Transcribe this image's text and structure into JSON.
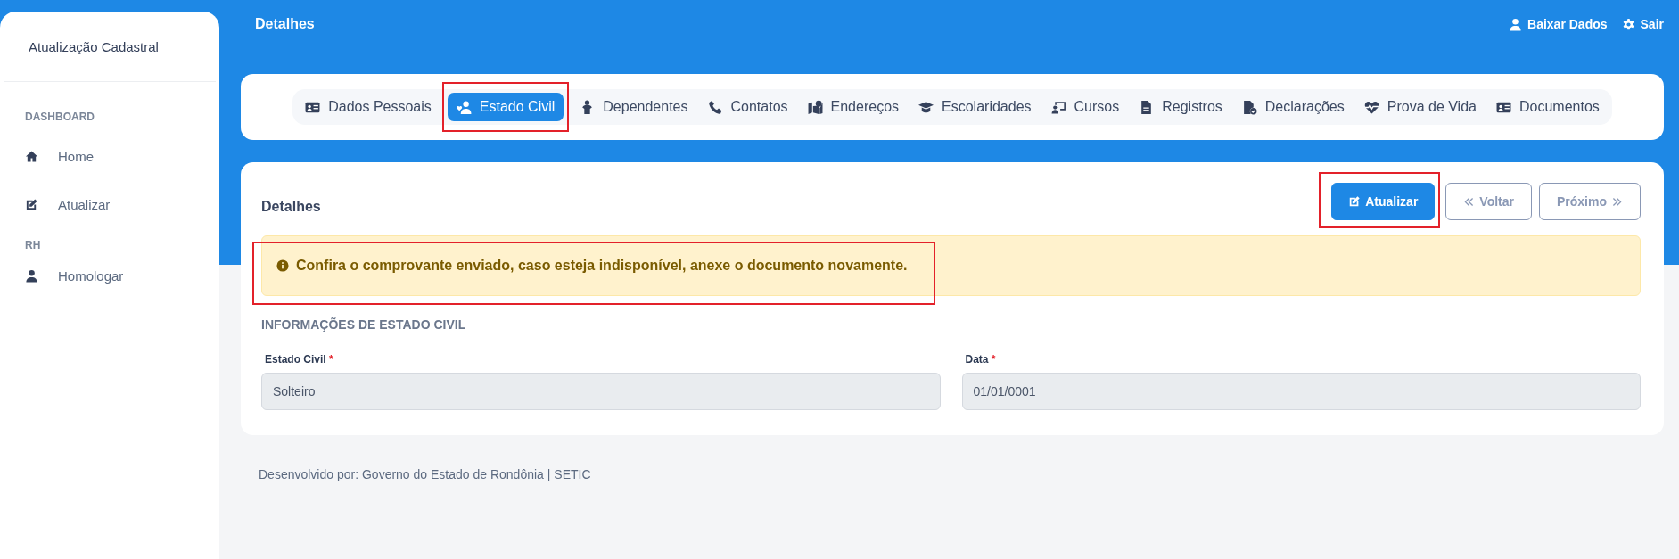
{
  "sidebar": {
    "title": "Atualização Cadastral",
    "sections": [
      {
        "heading": "DASHBOARD",
        "items": [
          {
            "label": "Home"
          },
          {
            "label": "Atualizar"
          }
        ]
      },
      {
        "heading": "RH",
        "items": [
          {
            "label": "Homologar"
          }
        ]
      }
    ]
  },
  "header": {
    "title": "Detalhes",
    "actions": [
      {
        "label": "Baixar Dados"
      },
      {
        "label": "Sair"
      }
    ]
  },
  "tabs": [
    {
      "label": "Dados Pessoais",
      "selected": false,
      "highlighted": false
    },
    {
      "label": "Estado Civil",
      "selected": true,
      "highlighted": true
    },
    {
      "label": "Dependentes",
      "selected": false,
      "highlighted": false
    },
    {
      "label": "Contatos",
      "selected": false,
      "highlighted": false
    },
    {
      "label": "Endereços",
      "selected": false,
      "highlighted": false
    },
    {
      "label": "Escolaridades",
      "selected": false,
      "highlighted": false
    },
    {
      "label": "Cursos",
      "selected": false,
      "highlighted": false
    },
    {
      "label": "Registros",
      "selected": false,
      "highlighted": false
    },
    {
      "label": "Declarações",
      "selected": false,
      "highlighted": false
    },
    {
      "label": "Prova de Vida",
      "selected": false,
      "highlighted": false
    },
    {
      "label": "Documentos",
      "selected": false,
      "highlighted": false
    }
  ],
  "details": {
    "title": "Detalhes",
    "buttons": [
      {
        "label": "Atualizar",
        "kind": "primary",
        "highlighted": true
      },
      {
        "label": "Voltar",
        "kind": "back",
        "highlighted": false
      },
      {
        "label": "Próximo",
        "kind": "next",
        "highlighted": false
      }
    ],
    "alert": {
      "text": "Confira o comprovante enviado, caso esteja indisponível, anexe o documento novamente.",
      "highlighted": true
    },
    "section_title": "INFORMAÇÕES DE ESTADO CIVIL",
    "fields": [
      {
        "label": "Estado Civil",
        "required_mark": "*",
        "value": "Solteiro"
      },
      {
        "label": "Data",
        "required_mark": "*",
        "value": "01/01/0001"
      }
    ]
  },
  "footer": "Desenvolvido por: Governo do Estado de Rondônia | SETIC"
}
